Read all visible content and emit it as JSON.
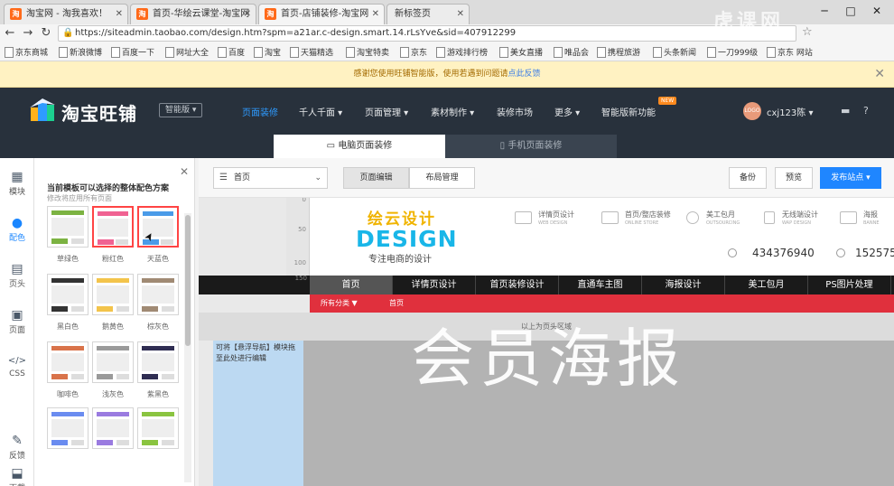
{
  "browser": {
    "tabs": [
      {
        "label": "淘宝网 - 淘我喜欢！",
        "favicon": "淘"
      },
      {
        "label": "首页-华绘云课堂-淘宝网",
        "favicon": "淘"
      },
      {
        "label": "首页-店铺装修-淘宝网",
        "favicon": "淘"
      },
      {
        "label": "新标签页",
        "favicon": ""
      }
    ],
    "url": "https://siteadmin.taobao.com/design.htm?spm=a21ar.c-design.smart.14.rLsYve&sid=407912299",
    "bookmarks": [
      "京东商城",
      "新浪微博",
      "百度一下",
      "网址大全",
      "百度",
      "淘宝",
      "天猫精选",
      "淘宝特卖",
      "京东",
      "游戏排行榜",
      "美女直播",
      "唯品会",
      "携程旅游",
      "头条新闻",
      "一刀999级",
      "京东 网站"
    ]
  },
  "notice": {
    "text": "感谢您使用旺铺智能版，使用若遇到问题请",
    "link": "点此反馈"
  },
  "header": {
    "logo": "淘宝旺铺",
    "edition": "智能版",
    "menu": [
      {
        "label": "页面装修",
        "active": true
      },
      {
        "label": "千人千面 ▾"
      },
      {
        "label": "页面管理 ▾"
      },
      {
        "label": "素材制作 ▾"
      },
      {
        "label": "装修市场"
      },
      {
        "label": "更多 ▾"
      },
      {
        "label": "智能版新功能"
      }
    ],
    "new_badge": "NEW",
    "avatar_text": "LOGO",
    "username": "cxj123陈 ▾",
    "mode_tabs": {
      "pc": "电脑页面装修",
      "mobile": "手机页面装修"
    }
  },
  "sidebar": {
    "items": [
      "模块",
      "配色",
      "页头",
      "页面",
      "CSS",
      "反馈",
      "下载"
    ]
  },
  "panel": {
    "title": "当前模板可以选择的整体配色方案",
    "subtitle": "修改将应用所有页面",
    "schemes": [
      {
        "label": "草绿色",
        "color": "#7cb342",
        "selected": false
      },
      {
        "label": "粉红色",
        "color": "#f06292",
        "selected": true
      },
      {
        "label": "天蓝色",
        "color": "#4a9be8",
        "selected": true
      },
      {
        "label": "黑白色",
        "color": "#333333",
        "selected": false
      },
      {
        "label": "鹅黄色",
        "color": "#f3c44b",
        "selected": false
      },
      {
        "label": "棕灰色",
        "color": "#a08a74",
        "selected": false
      },
      {
        "label": "咖啡色",
        "color": "#d9734a",
        "selected": false
      },
      {
        "label": "浅灰色",
        "color": "#9a9a9a",
        "selected": false
      },
      {
        "label": "紫黑色",
        "color": "#2f2d52",
        "selected": false
      },
      {
        "label": "",
        "color": "#6a8cf0",
        "selected": false
      },
      {
        "label": "",
        "color": "#9a7be0",
        "selected": false
      },
      {
        "label": "",
        "color": "#8ac440",
        "selected": false
      }
    ]
  },
  "toolbar": {
    "page_select": "首页",
    "seg_edit": "页面编辑",
    "seg_layout": "布局管理",
    "backup": "备份",
    "preview": "预览",
    "publish": "发布站点 ▾"
  },
  "canvas": {
    "ruler": [
      "0",
      "50",
      "100",
      "150"
    ],
    "brand_cn": "绘云设计",
    "brand_en": "DESIGN",
    "brand_slogan": "专注电商的设计",
    "services": [
      {
        "title": "详情页设计",
        "sub": "WEB DESIGN"
      },
      {
        "title": "首页/整店装修",
        "sub": "ONLINE STORE"
      },
      {
        "title": "美工包月",
        "sub": "OUTSOURCING"
      },
      {
        "title": "无线端设计",
        "sub": "WAP DESIGN"
      },
      {
        "title": "海报",
        "sub": "BANNE"
      }
    ],
    "qq1": "434376940",
    "qq2": "152575",
    "nav": [
      "首页",
      "详情页设计",
      "首页装修设计",
      "直通车主图",
      "海报设计",
      "美工包月",
      "PS图片处理"
    ],
    "subnav_all": "所有分类 ▼",
    "subnav_home": "首页",
    "divider_text": "以上为页头区域",
    "dropzone_text": "可将【悬浮导航】模块拖至此处进行编辑",
    "big_text": "会员海报"
  },
  "watermark": "虎课网"
}
